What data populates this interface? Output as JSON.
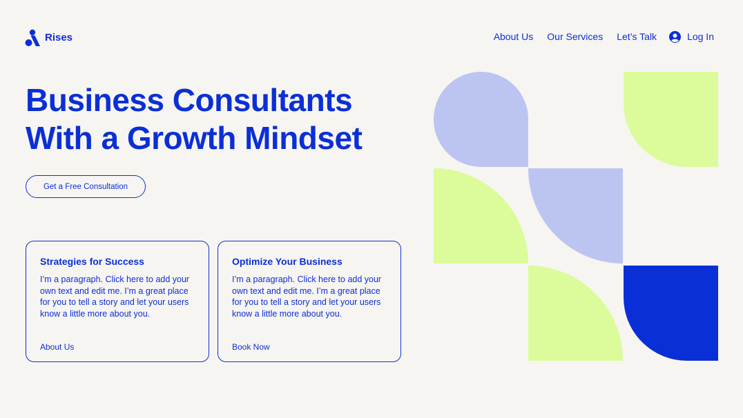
{
  "brand": {
    "name": "Rises"
  },
  "nav": {
    "links": [
      "About Us",
      "Our Services",
      "Let’s Talk"
    ],
    "login_label": "Log In"
  },
  "hero": {
    "title_lines": [
      "Business Consultants",
      "With a Growth Mindset"
    ],
    "cta_label": "Get a Free Consultation"
  },
  "cards": [
    {
      "title": "Strategies for Success",
      "body": "I’m a paragraph. Click here to add your own text and edit me. I’m a great place for you to tell a story and let your users know a little more about you.",
      "link": "About Us"
    },
    {
      "title": "Optimize Your Business",
      "body": "I’m a paragraph. Click here to add your own text and edit me. I’m a great place for you to tell a story and let your users know a little more about you.",
      "link": "Book Now"
    }
  ],
  "colors": {
    "accent": "#0b2fd6",
    "background": "#f7f5f2",
    "lavender": "#bcc5f1",
    "lime": "#dcfb9a"
  }
}
